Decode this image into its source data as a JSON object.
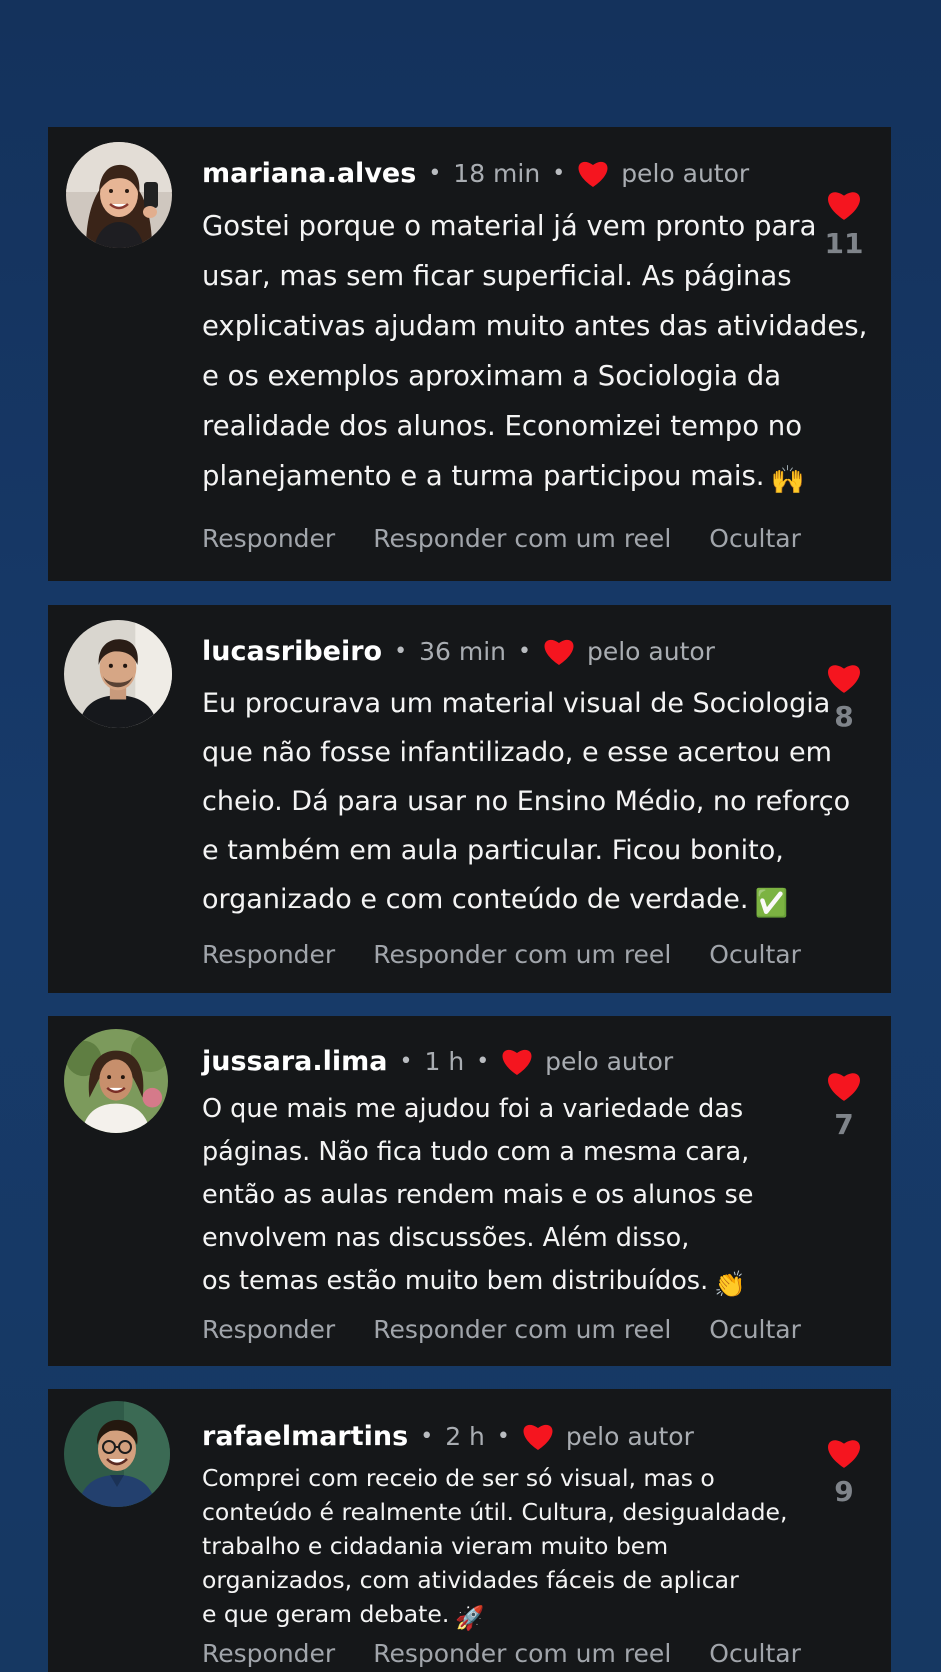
{
  "colors": {
    "background": "#163862",
    "card": "#151719",
    "heart": "#f5151f",
    "muted_text": "#a9adb2"
  },
  "author_label": "pelo autor",
  "actions": {
    "reply": "Responder",
    "reply_reel": "Responder com um reel",
    "hide": "Ocultar"
  },
  "comments": [
    {
      "username": "mariana.alves",
      "time": "18 min",
      "likes": "11",
      "lines": [
        "Gostei porque o material já vem pronto para",
        "usar, mas sem ficar superficial. As páginas",
        "explicativas ajudam muito antes das atividades,",
        "e os exemplos aproximam a Sociologia da",
        "realidade dos alunos. Economizei tempo no",
        "planejamento e a turma participou mais."
      ],
      "emoji": "🙌"
    },
    {
      "username": "lucasribeiro",
      "time": "36 min",
      "likes": "8",
      "lines": [
        "Eu procurava um material visual de Sociologia",
        "que não fosse infantilizado, e esse acertou em",
        "cheio. Dá para usar no Ensino Médio, no reforço",
        "e também em aula particular. Ficou bonito,",
        "organizado e com conteúdo de verdade."
      ],
      "emoji": "✅"
    },
    {
      "username": "jussara.lima",
      "time": "1 h",
      "likes": "7",
      "lines": [
        "O que mais me ajudou foi a variedade das",
        "páginas. Não fica tudo com a mesma cara,",
        "então as aulas rendem mais e os alunos se",
        "envolvem nas discussões. Além disso,",
        "os temas estão muito bem distribuídos."
      ],
      "emoji": "👏"
    },
    {
      "username": "rafaelmartins",
      "time": "2 h",
      "likes": "9",
      "lines": [
        "Comprei com receio de ser só visual, mas o",
        "conteúdo é realmente útil. Cultura, desigualdade,",
        "trabalho e cidadania vieram muito bem",
        "organizados, com atividades fáceis de aplicar",
        "e que geram debate."
      ],
      "emoji": "🚀"
    }
  ]
}
